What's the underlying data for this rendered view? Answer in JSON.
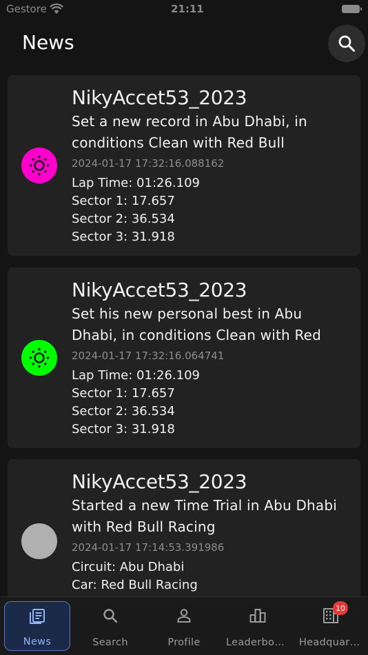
{
  "status_bar": {
    "carrier": "Gestore",
    "time": "21:11"
  },
  "header": {
    "title": "News"
  },
  "colors": {
    "background": "#141414",
    "card": "#222222",
    "active_tab": "#90b4f5",
    "badge": "#e53935"
  },
  "feed": [
    {
      "author": "NikyAccet53_2023",
      "message": "Set a new record in Abu Dhabi, in conditions Clean with Red Bull",
      "timestamp": "2024-01-17 17:32:16.088162",
      "avatar_color": "#ff00cc",
      "avatar_icon": "sun-icon",
      "details": [
        "Lap Time: 01:26.109",
        "Sector 1: 17.657",
        "Sector 2: 36.534",
        "Sector 3: 31.918"
      ]
    },
    {
      "author": "NikyAccet53_2023",
      "message": "Set his new personal best in Abu Dhabi, in conditions Clean with Red",
      "timestamp": "2024-01-17 17:32:16.064741",
      "avatar_color": "#00ff00",
      "avatar_icon": "sun-icon",
      "details": [
        "Lap Time: 01:26.109",
        "Sector 1: 17.657",
        "Sector 2: 36.534",
        "Sector 3: 31.918"
      ]
    },
    {
      "author": "NikyAccet53_2023",
      "message": "Started a new Time Trial in Abu Dhabi with Red Bull Racing",
      "timestamp": "2024-01-17 17:14:53.391986",
      "avatar_color": "#b0b0b0",
      "avatar_icon": "",
      "details": [
        "Circuit: Abu Dhabi",
        "Car: Red Bull Racing"
      ]
    }
  ],
  "tabs": [
    {
      "label": "News",
      "icon": "news-icon",
      "active": true
    },
    {
      "label": "Search",
      "icon": "search-icon",
      "active": false
    },
    {
      "label": "Profile",
      "icon": "person-icon",
      "active": false
    },
    {
      "label": "Leaderboard",
      "icon": "leaderboard-icon",
      "active": false
    },
    {
      "label": "Headquarters",
      "icon": "building-icon",
      "active": false,
      "badge": "10"
    }
  ]
}
